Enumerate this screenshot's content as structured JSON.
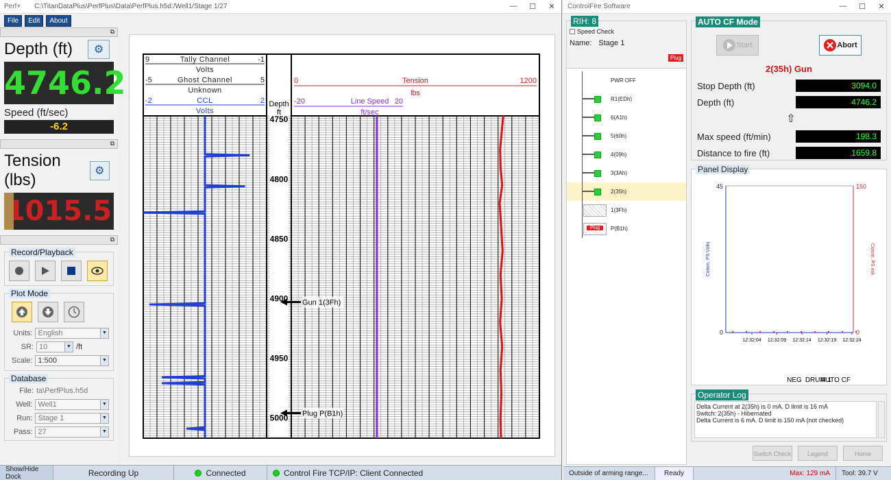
{
  "perf": {
    "app_title": "Perf+",
    "file_path": "C:\\TitanDataPlus\\PerfPlus\\Data\\PerfPlus.h5d:/Well1/Stage 1/27",
    "menu": [
      "File",
      "Edit",
      "About"
    ],
    "depth": {
      "label": "Depth (ft)",
      "value": "4746.2"
    },
    "speed": {
      "label": "Speed (ft/sec)",
      "value": "-6.2"
    },
    "tension": {
      "label": "Tension (lbs)",
      "value": "1015.5"
    },
    "record_playback": {
      "title": "Record/Playback"
    },
    "plot_mode": {
      "title": "Plot Mode",
      "units_label": "Units:",
      "units_value": "English",
      "sr_label": "SR:",
      "sr_value": "10",
      "sr_unit": "/ft",
      "scale_label": "Scale:",
      "scale_value": "1:500"
    },
    "database": {
      "title": "Database",
      "file_label": "File:",
      "file_value": "ta\\PerfPlus.h5d",
      "well_label": "Well:",
      "well_value": "Well1",
      "run_label": "Run:",
      "run_value": "Stage 1",
      "pass_label": "Pass:",
      "pass_value": "27"
    },
    "status": {
      "dock": "Show/Hide Dock",
      "recording": "Recording Up",
      "connected": "Connected",
      "cf": "Control Fire TCP/IP: Client Connected"
    }
  },
  "chart": {
    "left_track": [
      {
        "left": "9",
        "name": "Tally Channel",
        "right": "-1",
        "color": "#222222"
      },
      {
        "left": "",
        "name": "Volts",
        "right": "",
        "color": "#222222"
      },
      {
        "left": "-5",
        "name": "Ghost Channel",
        "right": "5",
        "color": "#222222"
      },
      {
        "left": "",
        "name": "Unknown",
        "right": "",
        "color": "#222222"
      },
      {
        "left": "-2",
        "name": "CCL",
        "right": "2",
        "color": "#1f3fd0"
      },
      {
        "left": "",
        "name": "Volts",
        "right": "",
        "color": "#1f3fd0"
      }
    ],
    "depth_header": [
      "Depth",
      "ft"
    ],
    "tension_header": {
      "min": "0",
      "name": "Tension",
      "max": "1200",
      "unit": "lbs",
      "color": "#c02020"
    },
    "speed_header": {
      "min": "-20",
      "name": "Line Speed",
      "max": "20",
      "unit": "ft/sec",
      "color": "#8a2be2"
    },
    "depth_ticks": [
      "4750",
      "4800",
      "4850",
      "4900",
      "4950",
      "5000"
    ],
    "markers": [
      {
        "label": "Gun 1(3Fh)",
        "depth": 4903
      },
      {
        "label": "Plug P(B1h)",
        "depth": 4996
      }
    ]
  },
  "chart_data": {
    "type": "line",
    "depth_range": [
      4747,
      5017
    ],
    "series": [
      {
        "name": "CCL",
        "axis_range": [
          -2,
          2
        ],
        "color": "#1f3fd0",
        "points": [
          [
            4747,
            0.0
          ],
          [
            4779,
            0.0
          ],
          [
            4780,
            1.45
          ],
          [
            4781,
            0.0
          ],
          [
            4805,
            0.0
          ],
          [
            4806,
            1.3
          ],
          [
            4807,
            0.0
          ],
          [
            4827,
            0.0
          ],
          [
            4828,
            -2.0
          ],
          [
            4829,
            0.0
          ],
          [
            4904,
            0.0
          ],
          [
            4905,
            -1.8
          ],
          [
            4906,
            0.0
          ],
          [
            4965,
            0.0
          ],
          [
            4966,
            -1.4
          ],
          [
            4967,
            0.0
          ],
          [
            4970,
            0.0
          ],
          [
            4971,
            -1.4
          ],
          [
            4972,
            0.0
          ],
          [
            5008,
            0.0
          ],
          [
            5009,
            -0.6
          ],
          [
            5010,
            0.0
          ],
          [
            5017,
            0.0
          ]
        ]
      },
      {
        "name": "Line Speed",
        "axis_range": [
          -20,
          20
        ],
        "color": "#8a2be2",
        "points": [
          [
            4747,
            -6.2
          ],
          [
            5017,
            -6.2
          ]
        ]
      },
      {
        "name": "Tension",
        "axis_range": [
          0,
          1200
        ],
        "color": "#e01010",
        "points": [
          [
            4747,
            1025
          ],
          [
            4760,
            1018
          ],
          [
            4775,
            1010
          ],
          [
            4790,
            1012
          ],
          [
            4805,
            1020
          ],
          [
            4820,
            1008
          ],
          [
            4840,
            1015
          ],
          [
            4860,
            1022
          ],
          [
            4880,
            1012
          ],
          [
            4900,
            1018
          ],
          [
            4920,
            1010
          ],
          [
            4940,
            1020
          ],
          [
            4960,
            1012
          ],
          [
            4980,
            1016
          ],
          [
            5000,
            1012
          ],
          [
            5017,
            1014
          ]
        ]
      }
    ]
  },
  "cf": {
    "app_title": "ControlFire Software",
    "rih": "RIH: 8",
    "speed_check": "Speed Check",
    "name_label": "Name:",
    "name_value": "Stage 1",
    "plug_badge": "Plug",
    "tree": [
      {
        "label": "PWR OFF",
        "state": "none"
      },
      {
        "label": "R1(EDh)",
        "state": "green"
      },
      {
        "label": "6(A1h)",
        "state": "green"
      },
      {
        "label": "5(60h)",
        "state": "green"
      },
      {
        "label": "4(09h)",
        "state": "green"
      },
      {
        "label": "3(3Ah)",
        "state": "green"
      },
      {
        "label": "2(35h)",
        "state": "green",
        "selected": true
      },
      {
        "label": "1(3Fh)",
        "state": "hatched"
      },
      {
        "label": "P(B1h)",
        "state": "plug"
      }
    ],
    "auto_mode": "AUTO CF Mode",
    "start": "Start",
    "abort": "Abort",
    "gun": "2(35h) Gun",
    "stop_depth": {
      "label": "Stop Depth (ft)",
      "value": "3094.0"
    },
    "depth": {
      "label": "Depth (ft)",
      "value": "4746.2"
    },
    "arrow": "⇧",
    "max_speed": {
      "label": "Max speed (ft/min)",
      "value": "198.3"
    },
    "dist_fire": {
      "label": "Distance to fire (ft)",
      "value": "1659.8"
    },
    "panel_display": "Panel Display",
    "panel_chart": {
      "left_max": "45",
      "left_min": "0",
      "right_max": "150",
      "right_min": "0",
      "left_label": "Comm. PS Volts",
      "right_label": "Comm. PS mA",
      "times": [
        "12:32:04",
        "12:32:09",
        "12:32:14",
        "12:32:19",
        "12:32:24"
      ],
      "footer": [
        "NEG",
        "DRUM 1",
        "AUTO CF"
      ]
    },
    "operator_log": "Operator Log",
    "log_lines": [
      "Delta Current at 2(35h) is 0 mA. D limit is 16 mA",
      "Switch: 2(35h) - Hibernated",
      "Delta Current is 6 mA. D limit is 150 mA (not checked)"
    ],
    "buttons": [
      "Switch Check",
      "Legend",
      "Home"
    ],
    "status": {
      "arming": "Outside of arming range...",
      "ready": "Ready",
      "max": "Max: 129 mA",
      "tool": "Tool: 39.7 V"
    }
  },
  "colors": {
    "depth_value": "#33dd33",
    "tension_value": "#cc2020",
    "speed_value": "#ffd500",
    "accent": "#1a8a7a"
  }
}
